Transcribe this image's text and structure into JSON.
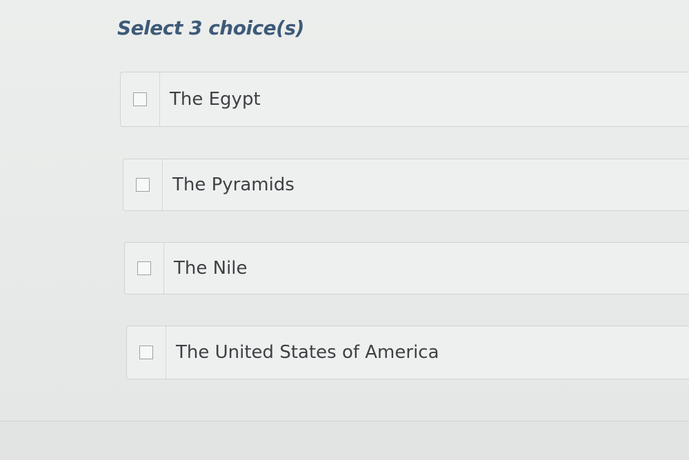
{
  "question": {
    "prompt": "Select 3 choice(s)"
  },
  "choices": [
    {
      "label": "The Egypt",
      "checked": false
    },
    {
      "label": "The Pyramids",
      "checked": false
    },
    {
      "label": "The Nile",
      "checked": false
    },
    {
      "label": "The United States of America",
      "checked": false
    }
  ],
  "colors": {
    "prompt_text": "#3e5a78",
    "choice_text": "#3d4144",
    "choice_border": "#cfd3d3",
    "checkbox_border": "#9aa0a2",
    "background": "#eceeed"
  }
}
